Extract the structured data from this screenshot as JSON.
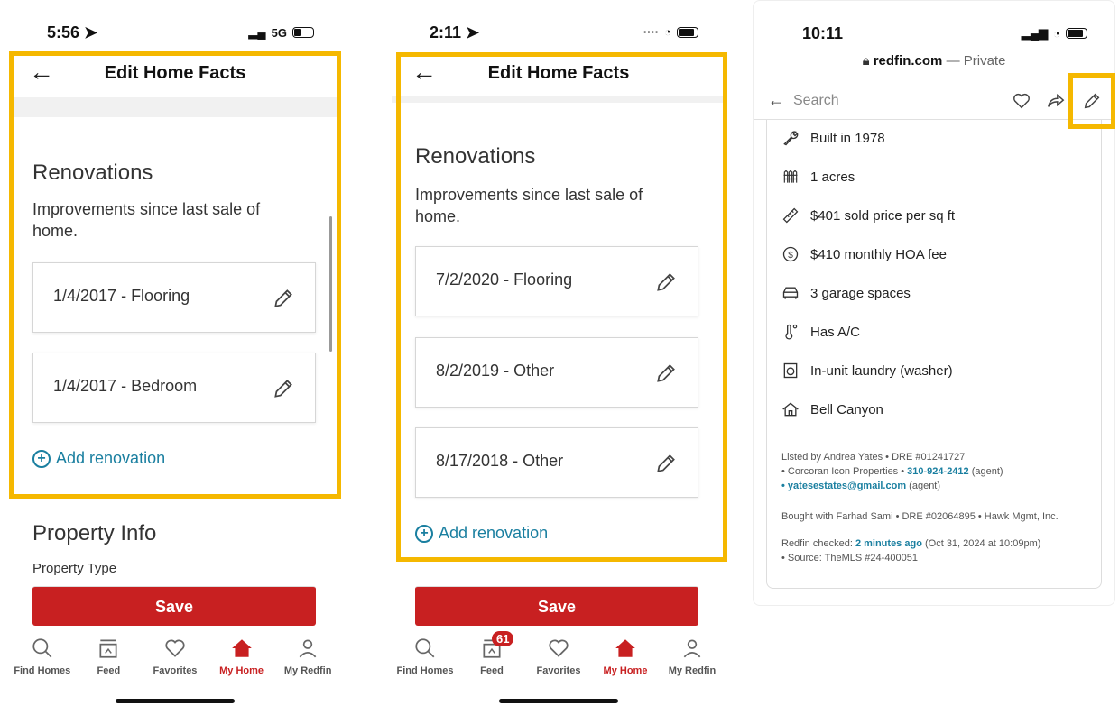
{
  "screen1": {
    "status": {
      "time": "5:56",
      "network": "5G"
    },
    "title": "Edit Home Facts",
    "section_title": "Renovations",
    "section_sub": "Improvements since last sale of home.",
    "renovations": [
      "1/4/2017 - Flooring",
      "1/4/2017 - Bedroom"
    ],
    "add_label": "Add renovation",
    "property_title": "Property Info",
    "property_type": "Property Type",
    "save_label": "Save"
  },
  "screen2": {
    "status": {
      "time": "2:11"
    },
    "title": "Edit Home Facts",
    "section_title": "Renovations",
    "section_sub": "Improvements since last sale of home.",
    "renovations": [
      "7/2/2020 - Flooring",
      "8/2/2019 - Other",
      "8/17/2018 - Other"
    ],
    "add_label": "Add renovation",
    "save_label": "Save",
    "feed_badge": "61"
  },
  "nav": [
    "Find Homes",
    "Feed",
    "Favorites",
    "My Home",
    "My Redfin"
  ],
  "screen3": {
    "status": {
      "time": "10:11"
    },
    "url_domain": "redfin.com",
    "url_suffix": "— Private",
    "search_placeholder": "Search",
    "facts": [
      {
        "icon": "wrench-icon",
        "text": "Built in 1978"
      },
      {
        "icon": "fence-icon",
        "text": "1 acres"
      },
      {
        "icon": "ruler-icon",
        "text": "$401 sold price per sq ft"
      },
      {
        "icon": "dollar-circle-icon",
        "text": "$410 monthly HOA fee"
      },
      {
        "icon": "car-icon",
        "text": "3 garage spaces"
      },
      {
        "icon": "thermometer-icon",
        "text": "Has A/C"
      },
      {
        "icon": "washer-icon",
        "text": "In-unit laundry (washer)"
      },
      {
        "icon": "house-icon",
        "text": "Bell Canyon"
      }
    ],
    "listed_by": "Listed by Andrea Yates • DRE #01241727",
    "office": "• Corcoran Icon Properties •",
    "phone": "310-924-2412",
    "agent_tag": "(agent)",
    "email_bullet": "•",
    "email": "yatesestates@gmail.com",
    "bought_with": "Bought with Farhad Sami • DRE #02064895 • Hawk Mgmt, Inc.",
    "checked_prefix": "Redfin checked:",
    "checked_link": "2 minutes ago",
    "checked_suffix": "(Oct 31, 2024 at 10:09pm)",
    "source": "• Source: TheMLS #24-400051"
  },
  "colors": {
    "highlight": "#f5b800",
    "brand_red": "#c82021",
    "link": "#1a7fa0"
  }
}
